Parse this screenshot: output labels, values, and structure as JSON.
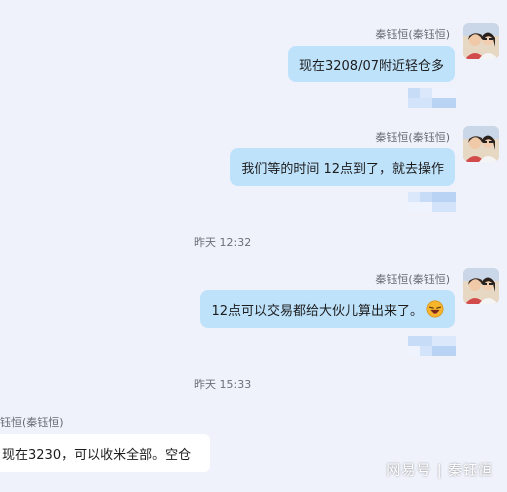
{
  "messages": [
    {
      "sender": "秦钰恒(秦钰恒)",
      "text": "现在3208/07附近轻仓多"
    },
    {
      "sender": "秦钰恒(秦钰恒)",
      "text": "我们等的时间 12点到了，就去操作"
    },
    {
      "sender": "秦钰恒(秦钰恒)",
      "text": "12点可以交易都给大伙儿算出来了。"
    },
    {
      "sender": "秦钰恒(秦钰恒)",
      "text": "现在3230，可以收米全部。空仓"
    }
  ],
  "timestamps": [
    "昨天 12:32",
    "昨天 15:33"
  ],
  "watermark": "网易号 | 秦钰恒",
  "icons": {
    "avatar": "user-avatar-icon",
    "emoji": "laughing-emoji-icon"
  },
  "colors": {
    "background": "#f0f2fb",
    "outgoing_bubble": "#bfe2fb",
    "incoming_bubble": "#ffffff"
  }
}
